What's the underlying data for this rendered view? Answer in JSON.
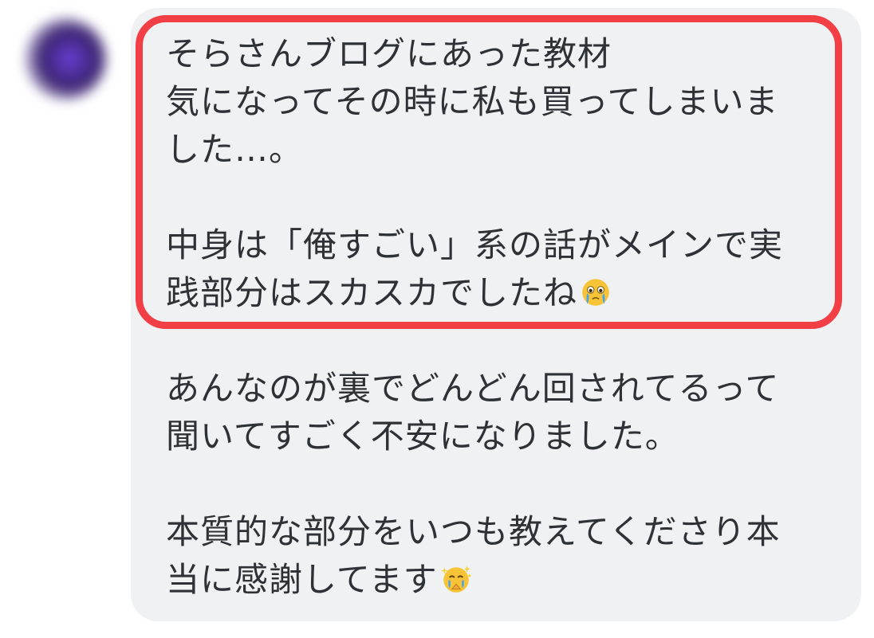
{
  "message": {
    "highlighted_lines": [
      "そらさんブログにあった教材",
      "気になってその時に私も買ってしまいま",
      "した…。",
      "",
      "中身は「俺すごい」系の話がメインで実",
      "践部分はスカスカでしたね"
    ],
    "lines_2": [
      "あんなのが裏でどんどん回されてるって",
      "聞いてすごく不安になりました。"
    ],
    "lines_3": [
      "本質的な部分をいつも教えてくださり本",
      "当に感謝してます"
    ],
    "emojis": [
      "crying-face-emoji",
      "grateful-face-emoji"
    ],
    "colors": {
      "bubble": "#eff1f3",
      "highlight_border": "#f23f46",
      "text": "#2e3236"
    }
  }
}
